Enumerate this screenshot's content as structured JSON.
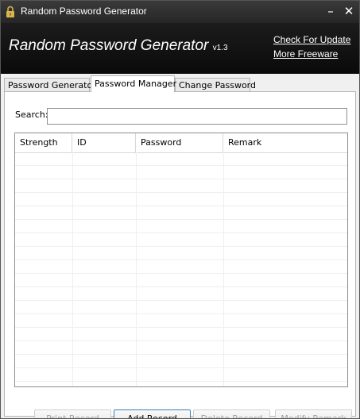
{
  "window": {
    "title": "Random Password Generator"
  },
  "header": {
    "app_name": "Random Password Generator",
    "version": "v1.3",
    "links": {
      "check_update": "Check For Update",
      "more_freeware": "More Freeware"
    }
  },
  "tabs": [
    {
      "label": "Password Generator"
    },
    {
      "label": "Password Manager"
    },
    {
      "label": "Change Password"
    }
  ],
  "manager": {
    "search_label": "Search:",
    "search_value": "",
    "columns": [
      "Strength",
      "ID",
      "Password",
      "Remark"
    ],
    "rows": []
  },
  "buttons": {
    "print": "Print Record",
    "add": "Add Record",
    "delete": "Delete Record",
    "modify": "Modify Remark"
  }
}
